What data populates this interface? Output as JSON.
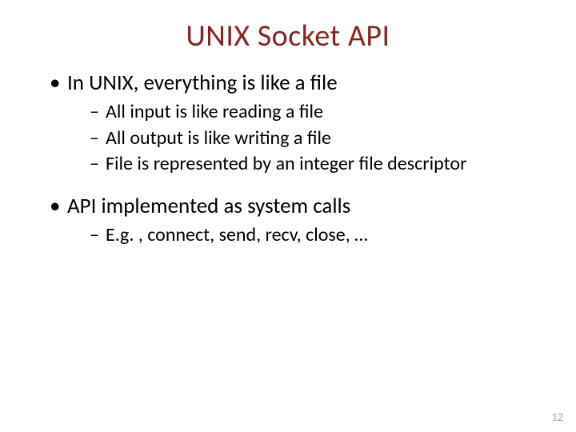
{
  "title": "UNIX Socket API",
  "bullets": [
    {
      "text": "In UNIX, everything is like a file",
      "sub": [
        "All input is like reading a file",
        "All output is like writing a file",
        "File is represented by an integer file descriptor"
      ]
    },
    {
      "text": "API implemented as system calls",
      "sub": [
        "E.g. , connect, send, recv, close, …"
      ]
    }
  ],
  "page_number": "12"
}
